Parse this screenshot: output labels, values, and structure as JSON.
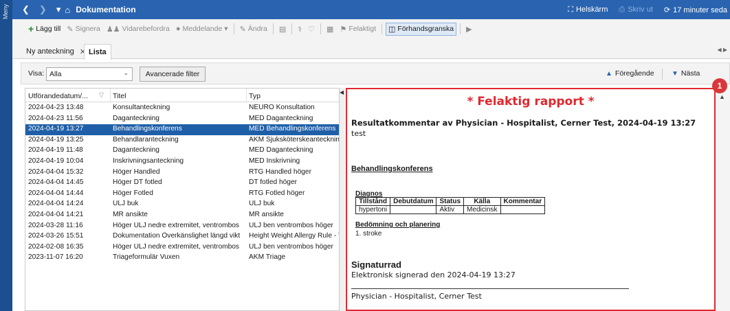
{
  "rail": {
    "label": "Meny"
  },
  "titlebar": {
    "title": "Dokumentation",
    "fullscreen_label": "Helskärm",
    "print_label": "Skriv ut",
    "refresh_label": "17 minuter seda"
  },
  "toolbar": {
    "add": "Lägg till",
    "sign": "Signera",
    "forward": "Vidarebefordra",
    "message": "Meddelande",
    "change": "Ändra",
    "wrong": "Felaktigt",
    "preview": "Förhandsgranska"
  },
  "tabs": {
    "tab1": "Ny anteckning",
    "tab2": "Lista"
  },
  "filter": {
    "visa_label": "Visa:",
    "visa_value": "Alla",
    "advanced": "Avancerade filter",
    "previous": "Föregående",
    "next": "Nästa"
  },
  "list": {
    "headers": {
      "date": "Utförandedatum/...",
      "title": "Titel",
      "type": "Typ"
    },
    "rows": [
      {
        "date": "2024-04-23 13:48",
        "title": "Konsultanteckning",
        "type": "NEURO Konsultation"
      },
      {
        "date": "2024-04-23 11:56",
        "title": "Daganteckning",
        "type": "MED Daganteckning"
      },
      {
        "date": "2024-04-19 13:27",
        "title": "Behandlingskonferens",
        "type": "MED Behandlingskonferens"
      },
      {
        "date": "2024-04-19 13:25",
        "title": "Behandlaranteckning",
        "type": "AKM Sjuksköterskeanteckning"
      },
      {
        "date": "2024-04-19 11:48",
        "title": "Daganteckning",
        "type": "MED Daganteckning"
      },
      {
        "date": "2024-04-19 10:04",
        "title": "Inskrivningsanteckning",
        "type": "MED Inskrivning"
      },
      {
        "date": "2024-04-04 15:32",
        "title": "Höger Handled",
        "type": "RTG Handled höger"
      },
      {
        "date": "2024-04-04 14:45",
        "title": "Höger DT fotled",
        "type": "DT fotled höger"
      },
      {
        "date": "2024-04-04 14:44",
        "title": "Höger Fotled",
        "type": "RTG Fotled höger"
      },
      {
        "date": "2024-04-04 14:24",
        "title": "ULJ buk",
        "type": "ULJ buk"
      },
      {
        "date": "2024-04-04 14:21",
        "title": "MR ansikte",
        "type": "MR ansikte"
      },
      {
        "date": "2024-03-28 11:16",
        "title": "Höger ULJ nedre extremitet, ventrombos",
        "type": "ULJ ben ventrombos höger"
      },
      {
        "date": "2024-03-26 15:51",
        "title": "Dokumentation Överkänslighet längd vikt",
        "type": "Height Weight Allergy Rule - Text"
      },
      {
        "date": "2024-02-08 16:35",
        "title": "Höger ULJ nedre extremitet, ventrombos",
        "type": "ULJ ben ventrombos höger"
      },
      {
        "date": "2023-11-07 16:20",
        "title": "Triageformulär Vuxen",
        "type": "AKM Triage"
      }
    ],
    "selected_index": 2
  },
  "preview": {
    "banner": "* Felaktig rapport *",
    "result_title": "Resultatkommentar av Physician - Hospitalist, Cerner Test, 2024-04-19 13:27",
    "comment": "test",
    "section": "Behandlingskonferens",
    "diagnosis_label": "Diagnos",
    "diagnosis_headers": [
      "Tillstånd",
      "Debutdatum",
      "Status",
      "Källa",
      "Kommentar"
    ],
    "diagnosis_row": [
      "hypertoni",
      "",
      "Aktiv",
      "Medicinsk",
      ""
    ],
    "plan_label": "Bedömning och planering",
    "plan_item": "1. stroke",
    "signature_heading": "Signaturrad",
    "signature_text": "Elektronisk signerad den 2024-04-19 13:27",
    "signer": "Physician - Hospitalist, Cerner Test"
  },
  "badge": {
    "number": "1"
  },
  "colors": {
    "titlebar": "#2a64b0",
    "rail": "#1b4f8f",
    "selected_row": "#1f5fa8",
    "alert_red": "#e0282e"
  }
}
